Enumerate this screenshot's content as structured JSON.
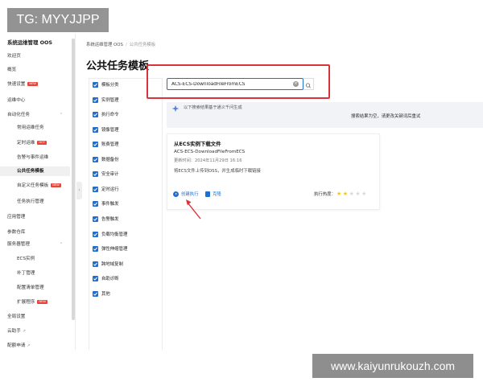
{
  "watermarks": {
    "top_left": "TG: MYYJJPP",
    "bottom_right": "www.kaiyunrukouzh.com"
  },
  "colors": {
    "accent": "#1f6fd0",
    "highlight_box": "#d9343b",
    "badge": "#e9443a",
    "star_on": "#f5c518",
    "star_off": "#d8d8d8"
  },
  "sidebar": {
    "title": "系统运维管理 OOS",
    "items": [
      {
        "label": "欢迎页"
      },
      {
        "label": "概览"
      },
      {
        "label": "快速设置",
        "badge": "NEW"
      },
      {
        "label": "运维中心"
      },
      {
        "label": "自动化任务",
        "expanded": true
      },
      {
        "label": "常用运维任务"
      },
      {
        "label": "定时运维",
        "badge": "HOT"
      },
      {
        "label": "告警与事件运维"
      },
      {
        "label": "公共任务模板",
        "active": true
      },
      {
        "label": "自定义任务模板",
        "badge": "NEW"
      },
      {
        "label": "任务执行管理"
      },
      {
        "label": "应用管理"
      },
      {
        "label": "参数仓库"
      },
      {
        "label": "服务器管理",
        "expanded": true
      },
      {
        "label": "ECS实例"
      },
      {
        "label": "补丁管理"
      },
      {
        "label": "配置清单管理"
      },
      {
        "label": "扩展程序",
        "badge": "NEW"
      },
      {
        "label": "全局设置"
      },
      {
        "label": "云助手",
        "external": true
      },
      {
        "label": "配额申请",
        "external": true
      }
    ]
  },
  "breadcrumb": {
    "root": "系统运维管理 OOS",
    "separator": "/",
    "current": "公共任务模板"
  },
  "page_title": "公共任务模板",
  "categories": [
    {
      "label": "模板分类",
      "checked": true
    },
    {
      "label": "实例管理",
      "checked": true
    },
    {
      "label": "执行命令",
      "checked": true
    },
    {
      "label": "镜像管理",
      "checked": true
    },
    {
      "label": "账费管理",
      "checked": true
    },
    {
      "label": "数据备份",
      "checked": true
    },
    {
      "label": "安全审计",
      "checked": true
    },
    {
      "label": "定时运行",
      "checked": true
    },
    {
      "label": "事件触发",
      "checked": true
    },
    {
      "label": "告警触发",
      "checked": true
    },
    {
      "label": "负载均衡管理",
      "checked": true
    },
    {
      "label": "弹性伸缩管理",
      "checked": true
    },
    {
      "label": "跨地域复制",
      "checked": true
    },
    {
      "label": "自助诊断",
      "checked": true
    },
    {
      "label": "其他",
      "checked": true
    }
  ],
  "search": {
    "value": "ACS-ECS-DownloadFileFromECS",
    "clear_icon": "clear-circle-icon",
    "search_icon": "magnifier-icon"
  },
  "info": {
    "ai_note": "以下搜索结果基于通义千问生成",
    "empty_hint": "搜索结果为空，请更改关键词后重试"
  },
  "card": {
    "title": "从ECS实例下载文件",
    "name": "ACS-ECS-DownloadFileFromECS",
    "date": "更新时间：2024年11月29日 16:16",
    "description": "将ECS文件上传到OSS，并生成临时下载链接",
    "actions": {
      "create": "创建执行",
      "clone": "克隆"
    },
    "heat_label": "执行热度：",
    "heat_rating": 2,
    "heat_max": 5
  }
}
